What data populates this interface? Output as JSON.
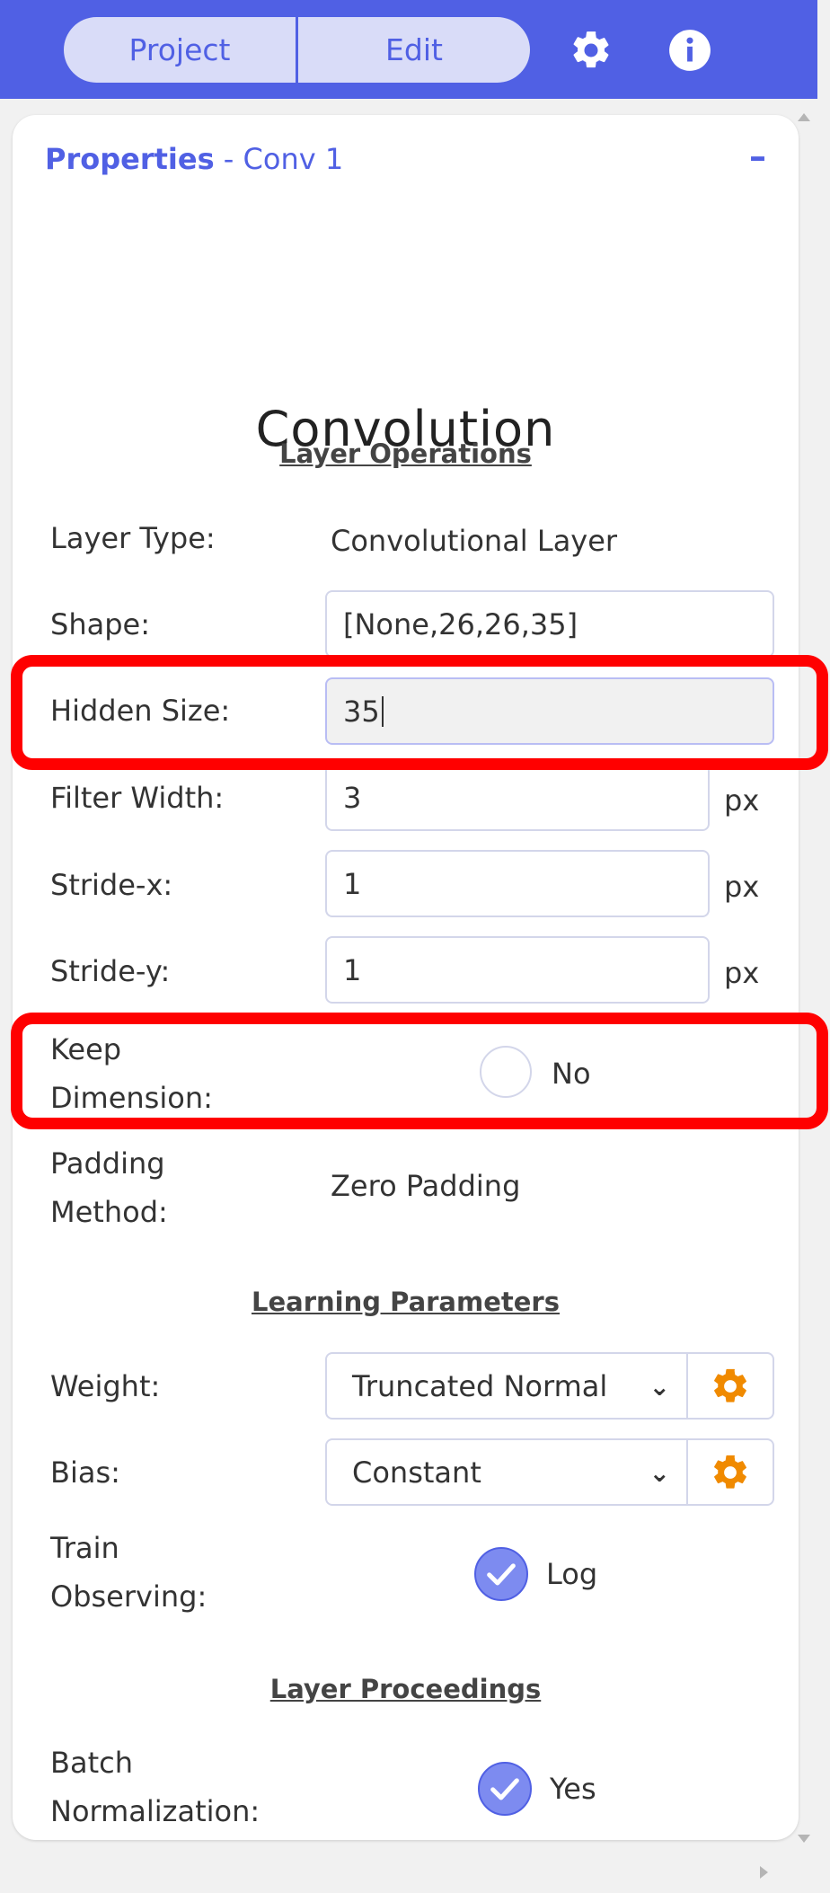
{
  "topbar": {
    "tabs": [
      {
        "label": "Project"
      },
      {
        "label": "Edit"
      }
    ],
    "settings_icon": "gear-icon",
    "info_icon": "info-icon",
    "background_color": "#5060e4"
  },
  "panel": {
    "header_strong": "Properties",
    "header_rest": " - Conv 1",
    "collapse_label": "–",
    "title": "Convolution"
  },
  "sections": {
    "layer_operations": "Layer Operations",
    "learning_parameters": "Learning Parameters",
    "layer_proceedings": "Layer Proceedings"
  },
  "fields": {
    "layer_type": {
      "label": "Layer Type:",
      "value": "Convolutional Layer"
    },
    "shape": {
      "label": "Shape:",
      "value": "[None,26,26,35]"
    },
    "hidden_size": {
      "label": "Hidden Size:",
      "value": "35"
    },
    "filter_width": {
      "label": "Filter Width:",
      "value": "3",
      "unit": "px"
    },
    "stride_x": {
      "label": "Stride-x:",
      "value": "1",
      "unit": "px"
    },
    "stride_y": {
      "label": "Stride-y:",
      "value": "1",
      "unit": "px"
    },
    "keep_dimension": {
      "label_line1": "Keep",
      "label_line2": "Dimension:",
      "value": "No",
      "checked": false
    },
    "padding_method": {
      "label_line1": "Padding",
      "label_line2": "Method:",
      "value": "Zero Padding"
    },
    "weight": {
      "label": "Weight:",
      "value": "Truncated Normal"
    },
    "bias": {
      "label": "Bias:",
      "value": "Constant"
    },
    "train_observing": {
      "label_line1": "Train",
      "label_line2": "Observing:",
      "value": "Log",
      "checked": true
    },
    "batch_normalization": {
      "label_line1": "Batch",
      "label_line2": "Normalization:",
      "value": "Yes",
      "checked": true
    }
  },
  "colors": {
    "accent": "#5060e4",
    "gear_orange": "#f08a00",
    "highlight_red": "#ff0000"
  }
}
